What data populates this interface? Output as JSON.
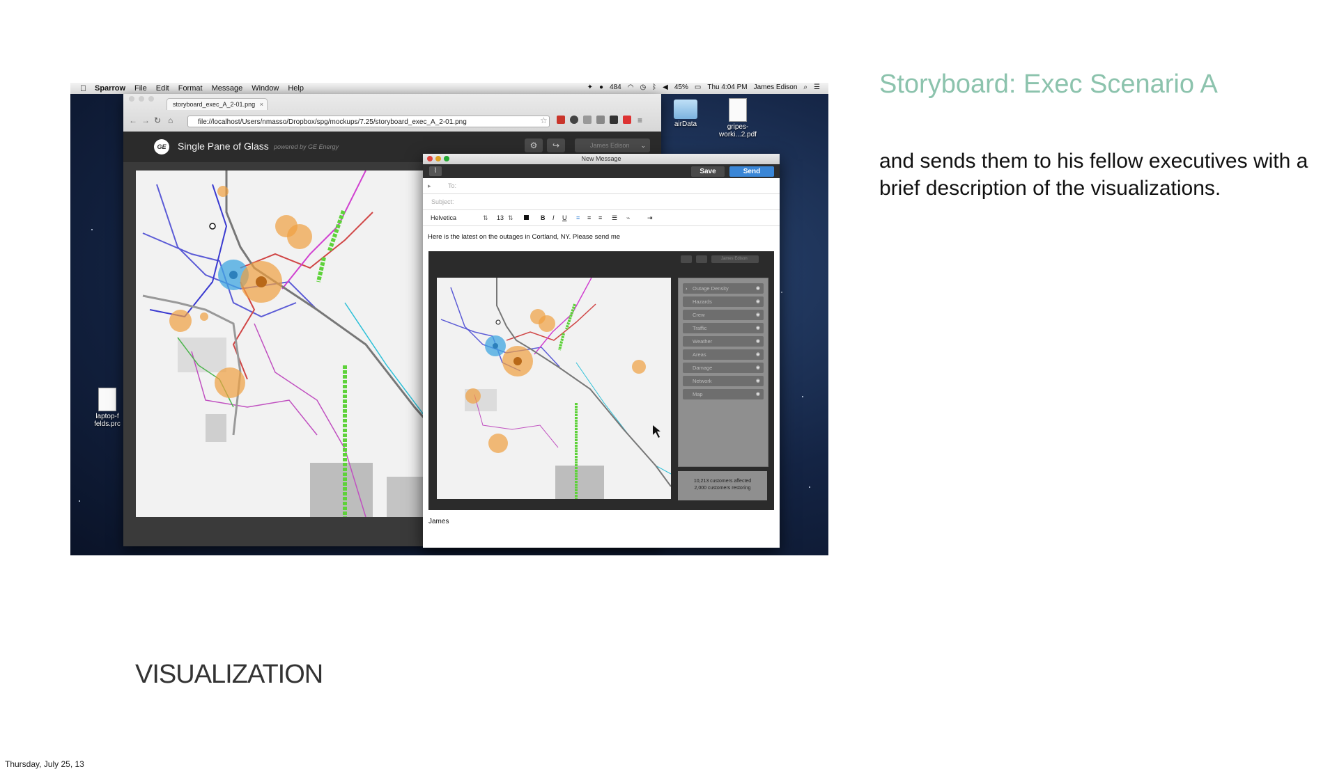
{
  "slide": {
    "title": "Storyboard: Exec Scenario A",
    "description": "and sends them to his fellow executives with a brief description of the visualizations.",
    "footer_label": "VISUALIZATION",
    "date": "Thursday, July 25, 13"
  },
  "menubar": {
    "app_name": "Sparrow",
    "items": [
      "File",
      "Edit",
      "Format",
      "Message",
      "Window",
      "Help"
    ],
    "status": {
      "count": "484",
      "battery": "45%",
      "clock": "Thu 4:04 PM",
      "user": "James Edison"
    }
  },
  "desktop": {
    "icons": [
      {
        "label": "airData"
      },
      {
        "label": "gripes-worki...2.pdf"
      },
      {
        "label": "laptop-f felds.prc"
      }
    ]
  },
  "browser": {
    "tab_title": "storyboard_exec_A_2-01.png",
    "tab_close": "×",
    "url": "file://localhost/Users/nmasso/Dropbox/spg/mockups/7.25/storyboard_exec_A_2-01.png"
  },
  "app": {
    "logo_text": "GE",
    "name": "Single Pane of Glass",
    "powered_by": "powered by GE Energy",
    "user": "James Edison"
  },
  "email": {
    "window_title": "New Message",
    "save_label": "Save",
    "send_label": "Send",
    "to_label": "To:",
    "subject_label": "Subject:",
    "font_name": "Helvetica",
    "font_size": "13",
    "body_text": "Here is the latest on the outages in Cortland, NY. Please send me",
    "signature": "James"
  },
  "embedded_app": {
    "user": "James Edison",
    "layers": [
      "Outage Density",
      "Hazards",
      "Crew",
      "Traffic",
      "Weather",
      "Areas",
      "Damage",
      "Network",
      "Map"
    ],
    "summary": [
      "10,213 customers affected",
      "2,000 customers restoring"
    ]
  },
  "colors": {
    "title_accent": "#8cc3ad",
    "send_button": "#3a86d6",
    "outage_circle": "#f0a040",
    "crew_circle": "#3fa6e0",
    "route_green": "#5ed23a"
  }
}
